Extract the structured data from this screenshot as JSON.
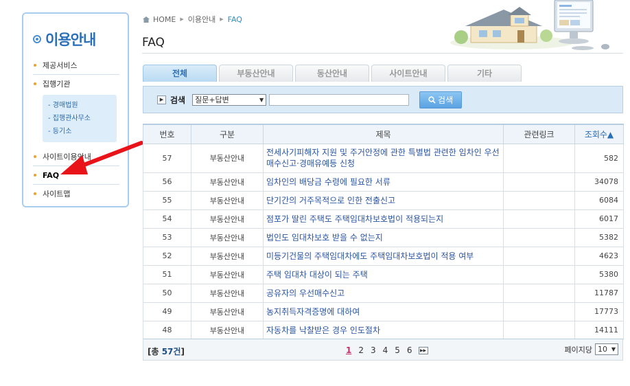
{
  "sidebar": {
    "title": "이용안내",
    "items": [
      {
        "label": "제공서비스"
      },
      {
        "label": "집행기관"
      },
      {
        "label": "사이트이용안내"
      },
      {
        "label": "FAQ"
      },
      {
        "label": "사이트맵"
      }
    ],
    "sub_items": [
      {
        "label": "경매법원"
      },
      {
        "label": "집행관사무소"
      },
      {
        "label": "등기소"
      }
    ]
  },
  "breadcrumb": {
    "home": "HOME",
    "section": "이용안내",
    "current": "FAQ"
  },
  "page_title": "FAQ",
  "tabs": [
    {
      "label": "전체",
      "active": true
    },
    {
      "label": "부동산안내",
      "active": false
    },
    {
      "label": "동산안내",
      "active": false
    },
    {
      "label": "사이트안내",
      "active": false
    },
    {
      "label": "기타",
      "active": false
    }
  ],
  "search": {
    "label": "검색",
    "select_value": "질문+답변",
    "input_value": "",
    "button_label": "검색"
  },
  "table": {
    "headers": [
      "번호",
      "구분",
      "제목",
      "관련링크",
      "조회수▲"
    ],
    "rows": [
      {
        "no": "57",
        "category": "부동산안내",
        "title": "전세사기피해자 지원 및 주거안정에 관한 특별법 관련한 임차인 우선매수신고·경매유예등 신청",
        "link": "",
        "views": "582"
      },
      {
        "no": "56",
        "category": "부동산안내",
        "title": "임차인의 배당금 수령에 필요한 서류",
        "link": "",
        "views": "34078"
      },
      {
        "no": "55",
        "category": "부동산안내",
        "title": "단기간의 거주목적으로 인한 전출신고",
        "link": "",
        "views": "6084"
      },
      {
        "no": "54",
        "category": "부동산안내",
        "title": "점포가 딸린 주택도 주택임대차보호법이 적용되는지",
        "link": "",
        "views": "6017"
      },
      {
        "no": "53",
        "category": "부동산안내",
        "title": "법인도 임대차보호 받을 수 없는지",
        "link": "",
        "views": "5382"
      },
      {
        "no": "52",
        "category": "부동산안내",
        "title": "미등기건물의 주택임대차에도 주택임대차보호법이 적용 여부",
        "link": "",
        "views": "4623"
      },
      {
        "no": "51",
        "category": "부동산안내",
        "title": "주택 임대차 대상이 되는 주택",
        "link": "",
        "views": "5380"
      },
      {
        "no": "50",
        "category": "부동산안내",
        "title": "공유자의 우선매수신고",
        "link": "",
        "views": "11787"
      },
      {
        "no": "49",
        "category": "부동산안내",
        "title": "농지취득자격증명에 대하여",
        "link": "",
        "views": "17773"
      },
      {
        "no": "48",
        "category": "부동산안내",
        "title": "자동차를 낙찰받은 경우 인도절차",
        "link": "",
        "views": "14111"
      }
    ]
  },
  "footer": {
    "total_prefix": "[총 ",
    "total_count": "57건",
    "total_suffix": "]",
    "pages": [
      "1",
      "2",
      "3",
      "4",
      "5",
      "6"
    ],
    "current_page": "1",
    "per_page_label": "페이지당",
    "per_page_value": "10"
  },
  "colors": {
    "accent": "#2a6fb8",
    "arrow": "#e8141a",
    "current_page": "#c0306a"
  },
  "icons": {
    "breadcrumb_home": "home-icon",
    "search_button": "search-icon",
    "pager_next": "next-page-icon"
  }
}
